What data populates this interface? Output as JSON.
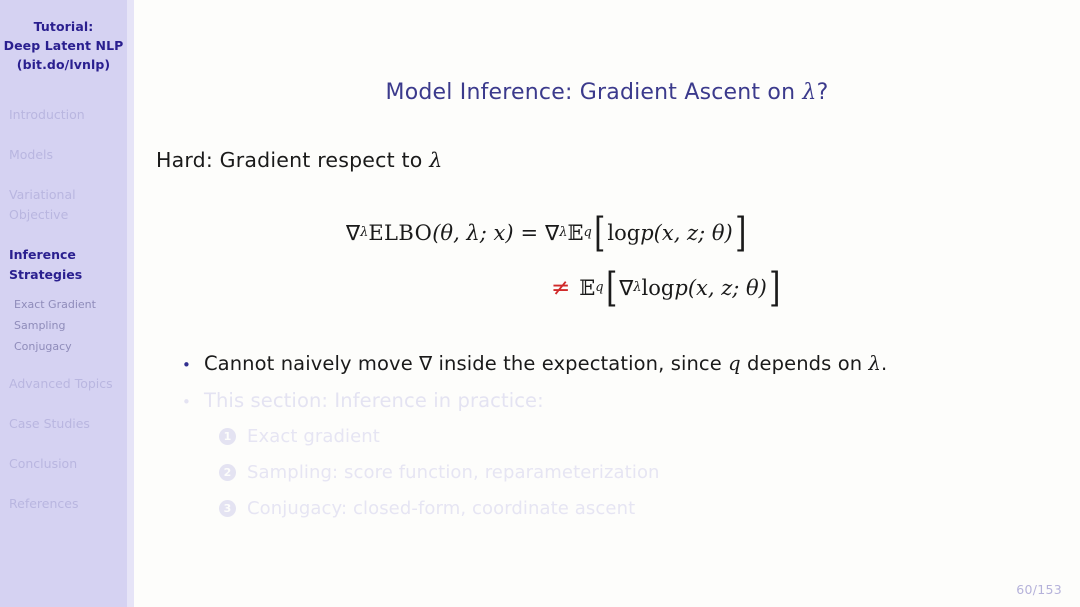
{
  "colors": {
    "sidebar_bg": "#d5d2f2",
    "page_bg": "#fdfdfb",
    "accent_navy": "#2a1f8f",
    "title_blue": "#3b3a8c",
    "dim_lavender": "#b9b6e0",
    "sub_item": "#8f8cba",
    "neq_red": "#d02a2a",
    "ghost_text": "#e4e3f2",
    "bullet_dot": "#32308f"
  },
  "sidebar": {
    "deck_title_lines": [
      "Tutorial:",
      "Deep Latent NLP",
      "(bit.do/lvnlp)"
    ],
    "toc": [
      {
        "label": "Introduction",
        "active": false
      },
      {
        "label": "Models",
        "active": false
      },
      {
        "label": "Variational",
        "active": false,
        "label2": "Objective"
      },
      {
        "label": "Inference",
        "active": true,
        "label2": "Strategies"
      },
      {
        "label": "Advanced Topics",
        "active": false
      },
      {
        "label": "Case Studies",
        "active": false
      },
      {
        "label": "Conclusion",
        "active": false
      },
      {
        "label": "References",
        "active": false
      }
    ],
    "subitems": [
      "Exact Gradient",
      "Sampling",
      "Conjugacy"
    ]
  },
  "slide": {
    "title_prefix": "Model Inference: Gradient Ascent on ",
    "title_symbol": "λ",
    "title_suffix": "?",
    "hard_label": "Hard:  Gradient respect to ",
    "hard_symbol": "λ",
    "equations": {
      "line1": {
        "lhs_nabla": "∇",
        "lhs_nabla_sub": "λ",
        "lhs_name": "ELBO",
        "lhs_args": "(θ, λ;  x)",
        "relation": "=",
        "rhs_nabla": "∇",
        "rhs_nabla_sub": "λ",
        "rhs_E": "𝔼",
        "rhs_E_sub": "q",
        "bracket_open": "[",
        "rhs_body_rm": "log ",
        "rhs_body_p": "p",
        "rhs_body_args": "(x, z; θ)",
        "bracket_close": "]"
      },
      "line2": {
        "relation": "≠",
        "E": "𝔼",
        "E_sub": "q",
        "bracket_open": "[",
        "nabla": "∇",
        "nabla_sub": "λ",
        "body_rm": "log ",
        "body_p": "p",
        "body_args": "(x, z; θ)",
        "bracket_close": "]"
      }
    },
    "bullets": [
      {
        "marker": "•",
        "text_a": "Cannot naively move ∇ inside the expectation, since ",
        "sym": "q",
        "text_b": " depends on ",
        "sym2": "λ",
        "text_c": ".",
        "dim": false
      },
      {
        "marker": "•",
        "text_a": "This section: Inference in practice:",
        "dim": true
      }
    ],
    "enumerated": [
      {
        "num": "1",
        "text": "Exact gradient"
      },
      {
        "num": "2",
        "text": "Sampling: score function, reparameterization"
      },
      {
        "num": "3",
        "text": "Conjugacy: closed-form, coordinate ascent"
      }
    ],
    "page_number": "60/153"
  }
}
